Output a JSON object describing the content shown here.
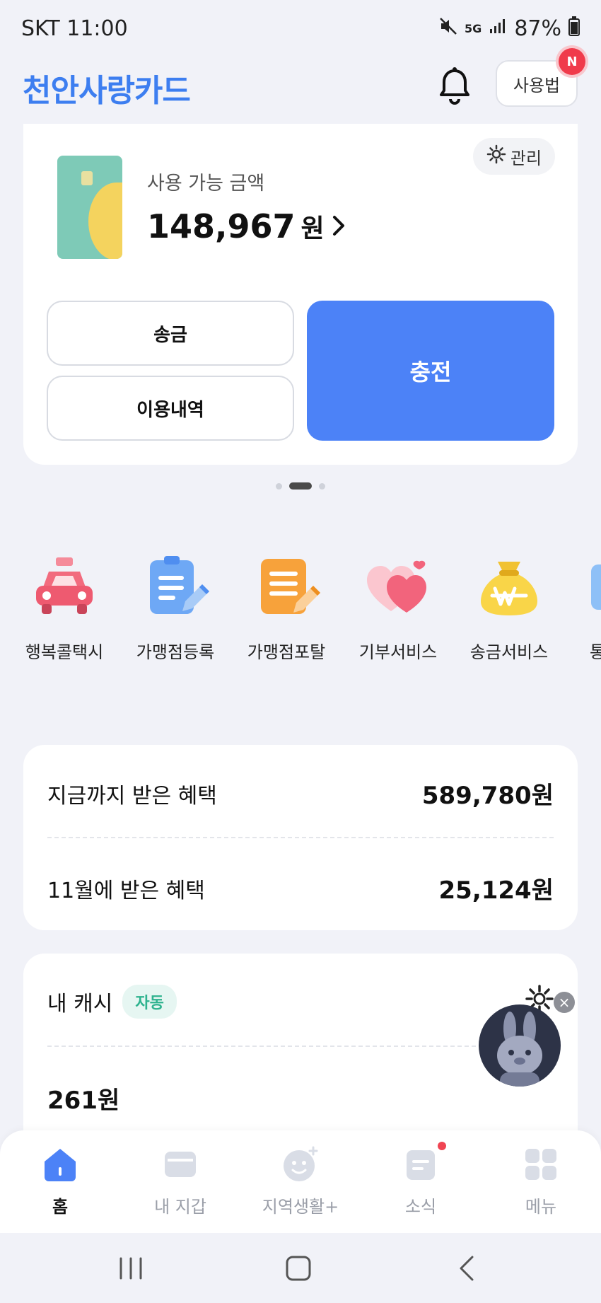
{
  "status_bar": {
    "carrier_time": "SKT 11:00",
    "battery": "87%",
    "network": "5G"
  },
  "header": {
    "title": "천안사랑카드",
    "guide_label": "사용법",
    "badge": "N"
  },
  "card": {
    "manage_label": "관리",
    "available_label": "사용 가능 금액",
    "available_amount": "148,967",
    "currency": "원",
    "send_label": "송금",
    "history_label": "이용내역",
    "charge_label": "충전"
  },
  "quick_menu": [
    {
      "label": "행복콜택시",
      "icon": "taxi-icon"
    },
    {
      "label": "가맹점등록",
      "icon": "clipboard-pen-icon"
    },
    {
      "label": "가맹점포탈",
      "icon": "document-pen-icon"
    },
    {
      "label": "기부서비스",
      "icon": "hearts-icon"
    },
    {
      "label": "송금서비스",
      "icon": "money-bag-icon"
    },
    {
      "label": "통",
      "icon": "partial-icon"
    }
  ],
  "benefits": {
    "total_label": "지금까지 받은 혜택",
    "total_value": "589,780원",
    "month_label": "11월에 받은 혜택",
    "month_value": "25,124원"
  },
  "cash": {
    "title": "내 캐시",
    "auto_badge": "자동",
    "amount": "261원"
  },
  "bottom_nav": [
    {
      "label": "홈",
      "active": true
    },
    {
      "label": "내 지갑",
      "active": false
    },
    {
      "label": "지역생활+",
      "active": false
    },
    {
      "label": "소식",
      "active": false
    },
    {
      "label": "메뉴",
      "active": false
    }
  ]
}
